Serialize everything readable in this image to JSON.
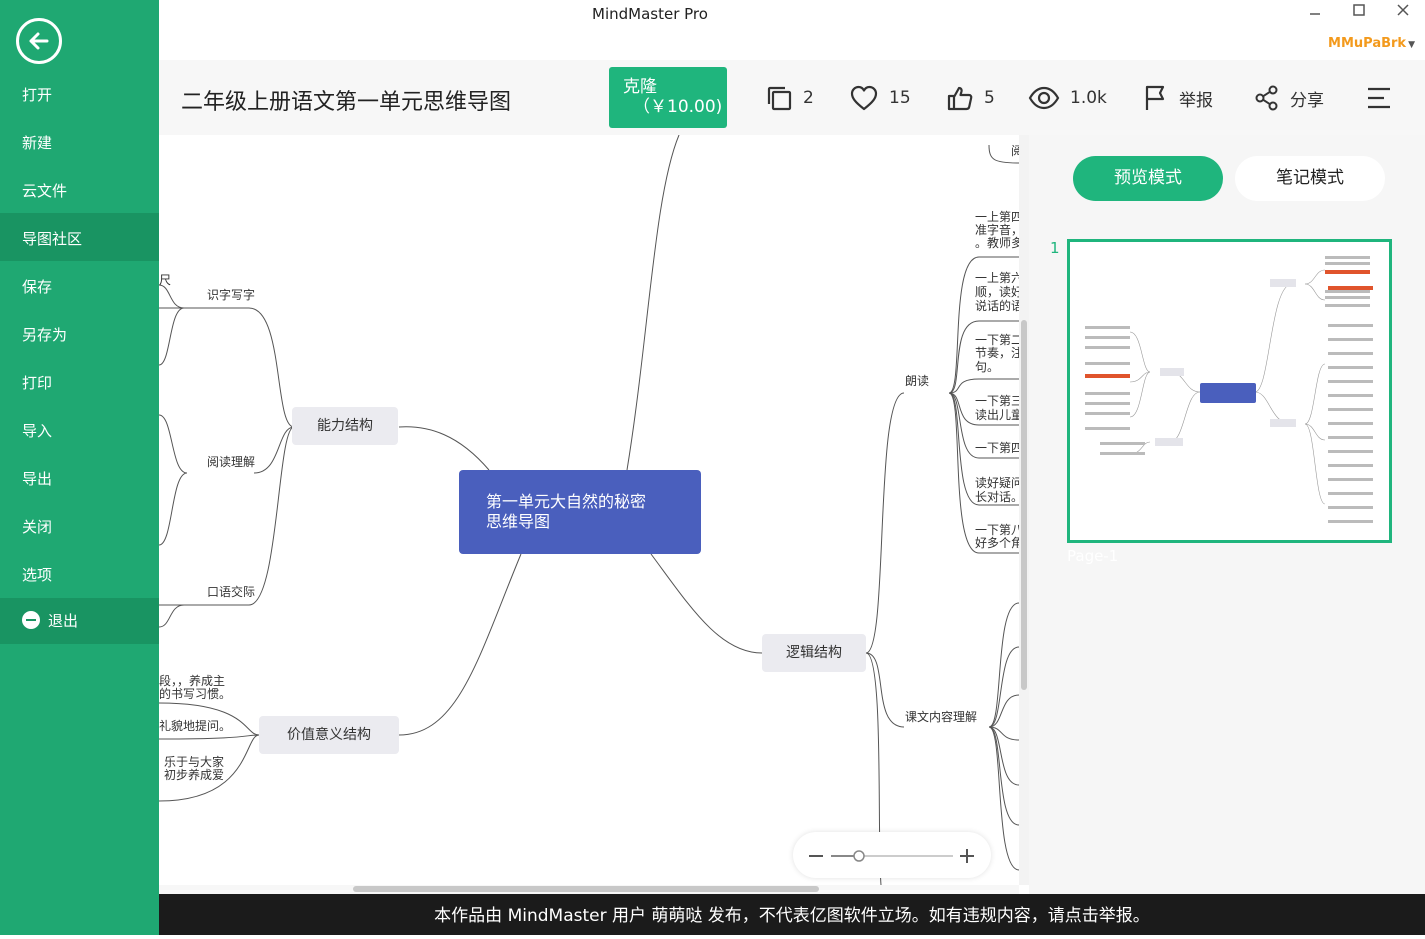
{
  "window": {
    "title": "MindMaster Pro",
    "user": "MMuPaBrk"
  },
  "sidebar": {
    "items": [
      {
        "label": "打开"
      },
      {
        "label": "新建"
      },
      {
        "label": "云文件"
      },
      {
        "label": "导图社区"
      },
      {
        "label": "保存"
      },
      {
        "label": "另存为"
      },
      {
        "label": "打印"
      },
      {
        "label": "导入"
      },
      {
        "label": "导出"
      },
      {
        "label": "关闭"
      },
      {
        "label": "选项"
      }
    ],
    "exit_label": "退出"
  },
  "header": {
    "doc_title": "二年级上册语文第一单元思维导图",
    "clone_label": "克隆",
    "clone_price": "（￥10.00)",
    "copies": "2",
    "favorites": "15",
    "likes": "5",
    "views": "1.0k",
    "report_label": "举报",
    "share_label": "分享"
  },
  "mindmap": {
    "root": [
      "第一单元大自然的秘密",
      "思维导图"
    ],
    "branches": {
      "ability": "能力结构",
      "value": "价值意义结构",
      "logic": "逻辑结构"
    },
    "ability_children": [
      "识字写字",
      "阅读理解",
      "口语交际"
    ],
    "logic_children": [
      "朗读",
      "课文内容理解"
    ],
    "leaves_left": [
      "尺",
      "段，，养成主",
      "的书写习惯。",
      "礼貌地提问。",
      "乐于与大家",
      "初步养成爱"
    ],
    "leaves_right": [
      "阅",
      "一上第四",
      "准字音，",
      "。教师多",
      "一上第六",
      "顺，读好",
      "说话的语",
      "一下第二",
      "节奏，注",
      "句。",
      "一下第三",
      "读出儿童",
      "一下第四",
      "读好疑问",
      "长对话。",
      "一下第八",
      "好多个角"
    ]
  },
  "panel": {
    "tabs": [
      "预览模式",
      "笔记模式"
    ],
    "page_number": "1",
    "page_label": "Page-1"
  },
  "footer": {
    "text": "本作品由 MindMaster 用户 萌萌哒 发布，不代表亿图软件立场。如有违规内容，请点击举报。"
  },
  "colors": {
    "brand_green": "#1fa872",
    "accent_green": "#1fb57d",
    "root_blue": "#4a5fbd",
    "user_orange": "#f39a1d"
  }
}
